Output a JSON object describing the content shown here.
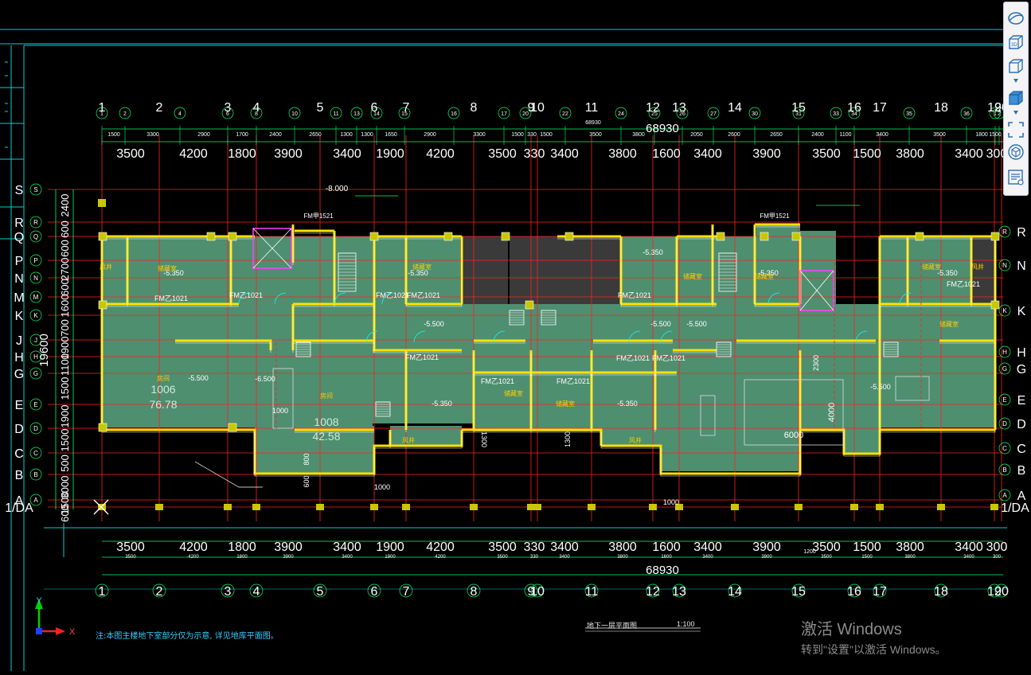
{
  "drawing": {
    "overall_dim": "68930",
    "overall_dim_small": "68930",
    "vertical_total": "19600",
    "top_dims_big": [
      "3500",
      "4200",
      "1800",
      "3900",
      "3400",
      "1900",
      "4200",
      "3500",
      "330",
      "3400",
      "3800",
      "1600",
      "3400",
      "3900",
      "3500",
      "1500",
      "3800",
      "3400",
      "300"
    ],
    "top_dims_small": [
      "1500",
      "3300",
      "2900",
      "1700",
      "2400",
      "2650",
      "1300",
      "1300",
      "1650",
      "2900",
      "3300",
      "1500",
      "330",
      "1500",
      "3500",
      "3800",
      "2050",
      "2600",
      "2650",
      "2400",
      "1100",
      "3400",
      "3500",
      "1800",
      "1500"
    ],
    "bottom_dims_big": [
      "3500",
      "4200",
      "1800",
      "3900",
      "3400",
      "1900",
      "4200",
      "3500",
      "330",
      "3400",
      "3800",
      "1600",
      "3400",
      "3900",
      "3500",
      "1500",
      "3800",
      "3400",
      "300"
    ],
    "axes_big": [
      "1",
      "2",
      "3",
      "4",
      "5",
      "6",
      "7",
      "8",
      "9",
      "10",
      "11",
      "12",
      "13",
      "14",
      "15",
      "16",
      "17",
      "18",
      "19",
      "20"
    ],
    "axes_small": [
      "1",
      "2",
      "4",
      "6",
      "8",
      "10",
      "11",
      "13",
      "14",
      "15",
      "16",
      "17",
      "20",
      "22",
      "24",
      "25",
      "26",
      "27",
      "30",
      "31",
      "33",
      "34",
      "35",
      "36"
    ],
    "row_axes_left": [
      "S",
      "R",
      "Q",
      "P",
      "N",
      "M",
      "K",
      "J",
      "H",
      "G",
      "E",
      "D",
      "C",
      "B",
      "A"
    ],
    "row_axes_right": [
      "R",
      "Q",
      "N",
      "M",
      "K",
      "J",
      "H",
      "G",
      "E",
      "D",
      "C",
      "B",
      "A"
    ],
    "row_axes_right_big": [
      "R",
      "N",
      "K",
      "H",
      "G",
      "E",
      "D",
      "C",
      "B",
      "A"
    ],
    "row_axis_extra": "1/DA",
    "left_dims": [
      "2400",
      "600",
      "600",
      "2700",
      "600",
      "1600",
      "700",
      "1900",
      "1100",
      "1500",
      "1900",
      "1500",
      "500",
      "3000",
      "1500",
      "600"
    ],
    "rooms": [
      {
        "num": "1006",
        "area": "76.78"
      },
      {
        "num": "1008",
        "area": "42.58"
      }
    ],
    "labels": {
      "level_minus8": "-8.000",
      "elev_5350": "-5.350",
      "elev_5500": "-5.500",
      "elev_6500": "-6.500",
      "fm": "FM乙1021",
      "fmj": "FM甲1521",
      "window": "风井",
      "storage": "储藏室",
      "room": "房间",
      "dim_1000": "1000",
      "dim_1300": "1300",
      "dim_6000": "6000",
      "dim_4000": "4000",
      "dim_800": "800",
      "dim_600": "600",
      "dim_2300": "2300",
      "dim_1200": "1200"
    }
  },
  "note": "注:本图主楼地下室部分仅为示意, 详见地库平面图。",
  "title": "地下一层平面图",
  "scale": "1:100",
  "ucs": {
    "x": "X",
    "y": "Y"
  },
  "watermark": {
    "line1": "激活 Windows",
    "line2": "转到\"设置\"以激活 Windows。"
  },
  "toolbar": [
    {
      "name": "orbit-icon"
    },
    {
      "name": "3d-view-icon"
    },
    {
      "name": "box-view-icon"
    },
    {
      "name": "expand-view-icon"
    },
    {
      "name": "viewcube-selected-icon"
    },
    {
      "name": "zoom-extents-icon"
    },
    {
      "name": "isometric-view-icon"
    },
    {
      "name": "properties-panel-icon"
    }
  ],
  "colors": {
    "background": "#000000",
    "grid": "#ff2020",
    "wall": "#ffe100",
    "room_fill": "#4e8f70",
    "dims": "#00ff66",
    "cyan": "#00d0d0",
    "white": "#ffffff",
    "door": "#00ffff"
  }
}
